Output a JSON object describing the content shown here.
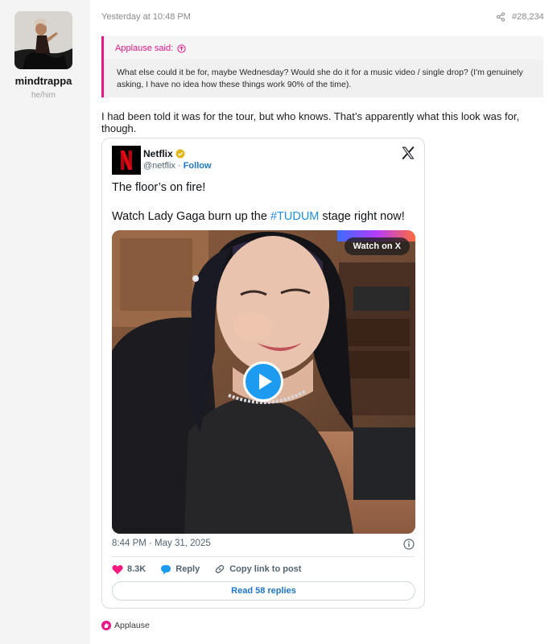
{
  "user": {
    "name": "mindtrappa",
    "pronouns": "he/him"
  },
  "post": {
    "timestamp": "Yesterday at 10:48 PM",
    "number": "#28,234",
    "text": "I had been told it was for the tour, but who knows. That’s apparently what this look was for, though."
  },
  "quote": {
    "author_line": "Applause said:",
    "body": "What else could it be for, maybe Wednesday? Would she do it for a music video / single drop? (I'm genuinely asking, I have no idea how these things work 90% of the time)."
  },
  "tweet": {
    "name": "Netflix",
    "handle": "@netflix",
    "separator": "·",
    "follow": "Follow",
    "line1": "The floor’s on fire!",
    "line2_pre": "Watch Lady Gaga burn up the ",
    "hashtag": "#TUDUM",
    "line2_post": " stage right now!",
    "watch_label": "Watch on X",
    "time": "8:44 PM · May 31, 2025",
    "likes": "8.3K",
    "reply": "Reply",
    "copy_link": "Copy link to post",
    "read_replies": "Read 58 replies"
  },
  "reaction": {
    "label": "Applause"
  },
  "colors": {
    "accent": "#e8178a",
    "link": "#1d76c9",
    "hashtag": "#1d8ee3",
    "netflix_red": "#e50914",
    "heart": "#f91880",
    "reply_icon": "#1d9bf0"
  },
  "icons": [
    "share-icon",
    "arrow-up-circle-icon",
    "netflix-logo",
    "verified-icon",
    "x-logo-icon",
    "play-icon",
    "info-icon",
    "heart-icon",
    "reply-bubble-icon",
    "link-icon",
    "applause-icon"
  ]
}
